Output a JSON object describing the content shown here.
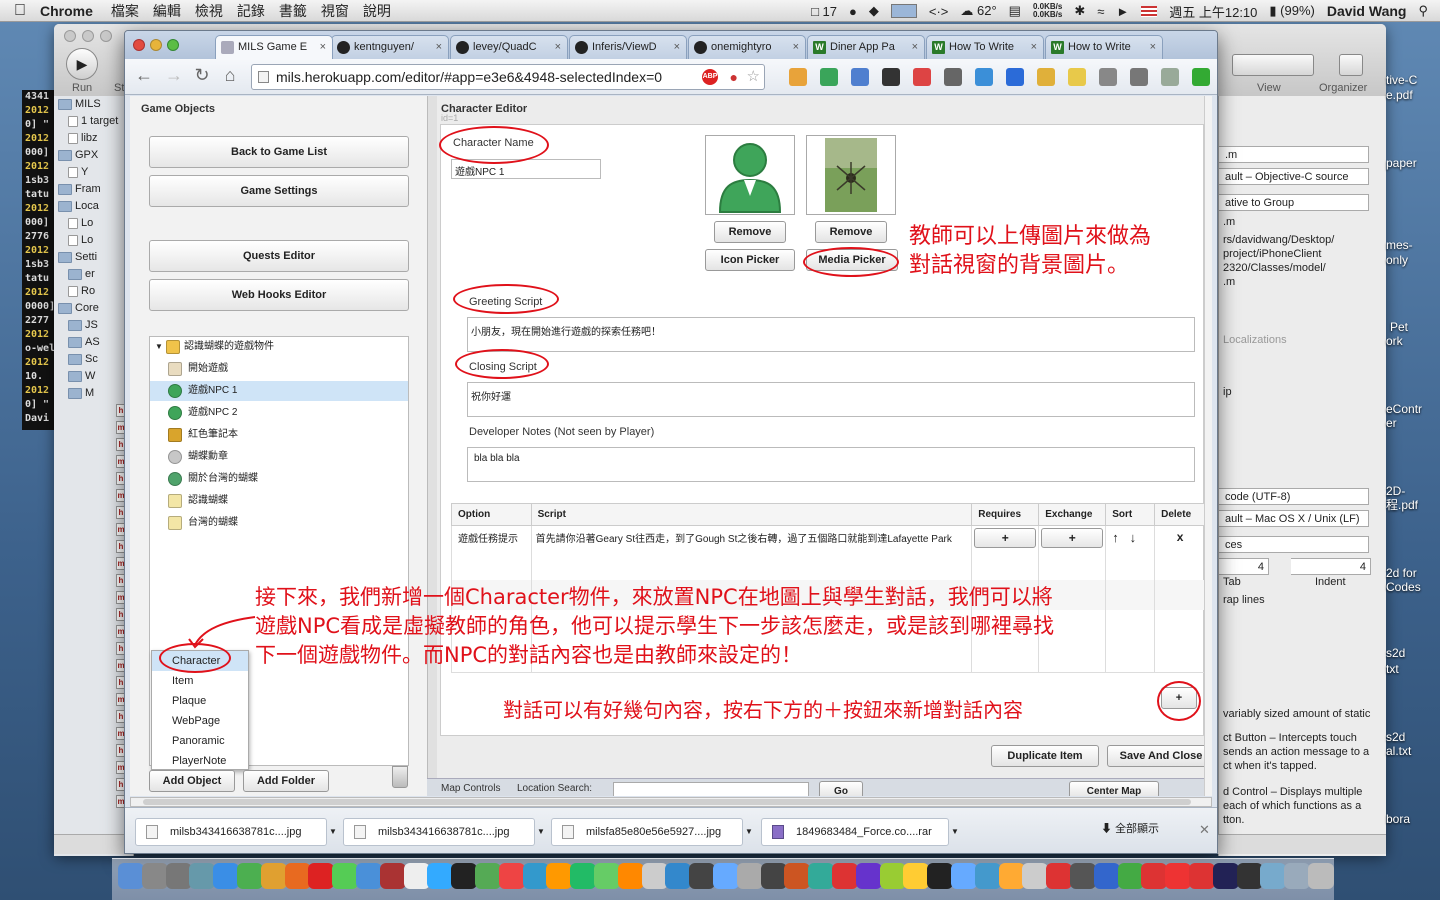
{
  "menubar": {
    "app_name": "Chrome",
    "menus": [
      "檔案",
      "編輯",
      "檢視",
      "記錄",
      "書籤",
      "視窗",
      "說明"
    ],
    "badge_count": "17",
    "temperature": "62°",
    "net_up": "0.0KB/s",
    "net_down": "0.0KB/s",
    "clock": "週五 上午12:10",
    "battery": "(99%)",
    "user": "David Wang"
  },
  "xcode": {
    "run_label": "Run",
    "stop_label": "St",
    "view_label": "View",
    "organizer_label": "Organizer",
    "nav_items": [
      "MILS",
      "1 target",
      "libz",
      "GPX",
      "Y",
      "Fram",
      "Loca",
      "Lo",
      "Lo",
      "Setti",
      "er",
      "Ro",
      "Core",
      "JS",
      "AS",
      "Sc",
      "W",
      "M"
    ],
    "right_fields": [
      ".m",
      "ault – Objective-C source",
      "ative to Group",
      ".m",
      "rs/davidwang/Desktop/",
      "project/iPhoneClient",
      "2320/Classes/model/",
      ".m",
      "Localizations",
      "ip",
      "code (UTF-8)",
      "ault – Mac OS X / Unix (LF)",
      "ces",
      "4",
      "4",
      "Tab",
      "Indent",
      "rap lines",
      "variably sized amount of static",
      "ct Button – Intercepts touch",
      "sends an action message to a",
      "ct when it's tapped.",
      "d Control – Displays multiple",
      "each of which functions as a",
      "tton."
    ]
  },
  "terminal_lines": [
    "4341",
    "2012",
    "0] \"",
    "2012",
    "000]",
    "2012",
    "1sb3",
    "tatu",
    "2012",
    "000]",
    "2776",
    "2012",
    "1sb3",
    "tatu",
    "2012",
    "0000]",
    "2277",
    "2012",
    "o-wel",
    "2012",
    "10.",
    "2012",
    "0] \"",
    "Davi"
  ],
  "desktop_files": [
    "tive-C",
    "e.pdf",
    "paper",
    "mes-",
    "only",
    "Pet",
    "ork",
    "eContr",
    "er",
    "2D-",
    "程.pdf",
    "2d for",
    "Codes",
    "s2d",
    "txt",
    "s2d",
    "al.txt",
    "bora"
  ],
  "browser": {
    "tabs": [
      "MILS Game E",
      "kentnguyen/",
      "levey/QuadC",
      "Inferis/ViewD",
      "onemightyro",
      "Diner App Pa",
      "How To Write",
      "How to Write"
    ],
    "url": "mils.herokuapp.com/editor/#app=e3e6&4948-selectedIndex=0"
  },
  "left_panel": {
    "title": "Game Objects",
    "buttons": [
      "Back to Game List",
      "Game Settings",
      "Quests Editor",
      "Web Hooks Editor"
    ],
    "tree": [
      {
        "label": "認識蝴蝶的遊戲物件",
        "icon": "folder-icon"
      },
      {
        "label": "開始遊戲",
        "icon": "scroll-icon"
      },
      {
        "label": "遊戲NPC 1",
        "icon": "person-icon"
      },
      {
        "label": "遊戲NPC 2",
        "icon": "person-icon"
      },
      {
        "label": "紅色筆記本",
        "icon": "box-icon"
      },
      {
        "label": "蝴蝶勳章",
        "icon": "medal-icon"
      },
      {
        "label": "關於台灣的蝴蝶",
        "icon": "globe-icon"
      },
      {
        "label": "認識蝴蝶",
        "icon": "page-icon"
      },
      {
        "label": "台灣的蝴蝶",
        "icon": "page-icon"
      }
    ],
    "popup_items": [
      "Character",
      "Item",
      "Plaque",
      "WebPage",
      "Panoramic",
      "PlayerNote"
    ],
    "add_object": "Add Object",
    "add_folder": "Add Folder"
  },
  "editor": {
    "title": "Character Editor",
    "id_label": "id=1",
    "name_label": "Character Name",
    "name_value": "遊戲NPC 1",
    "remove_label": "Remove",
    "remove2_label": "Remove",
    "icon_picker": "Icon Picker",
    "media_picker": "Media Picker",
    "greeting_label": "Greeting Script",
    "greeting_value": "小朋友，現在開始進行遊戲的探索任務吧！",
    "closing_label": "Closing Script",
    "closing_value": "祝你好運",
    "notes_label": "Developer Notes (Not seen by Player)",
    "notes_value": "bla bla bla",
    "table_headers": [
      "Option",
      "Script",
      "Requires",
      "Exchange",
      "Sort",
      "Delete"
    ],
    "row": {
      "option": "遊戲任務提示",
      "script": "首先請你沿著Geary St往西走，到了Gough St之後右轉，過了五個路口就能到達Lafayette Park",
      "requires": "+",
      "exchange": "+",
      "sort_up": "↑",
      "sort_down": "↓",
      "delete": "x"
    },
    "add_row": "+",
    "duplicate": "Duplicate Item",
    "save": "Save And Close",
    "map_controls": "Map Controls",
    "location_search": "Location Search:",
    "go": "Go",
    "center_map": "Center Map"
  },
  "annotations": {
    "media_note_1": "教師可以上傳圖片來做為",
    "media_note_2": "對話視窗的背景圖片。",
    "char_note_1": "接下來，我們新增一個Character物件，來放置NPC在地圖上與學生對話，我們可以將",
    "char_note_2": "遊戲NPC看成是虛擬教師的角色，他可以提示學生下一步該怎麼走，或是該到哪裡尋找",
    "char_note_3": "下一個遊戲物件。而NPC的對話內容也是由教師來設定的！",
    "add_note": "對話可以有好幾句內容，按右下方的＋按鈕來新增對話內容"
  },
  "downloads": {
    "items": [
      "milsb343416638781c....jpg",
      "milsb343416638781c....jpg",
      "milsfa85e80e56e5927....jpg",
      "1849683484_Force.co....rar"
    ],
    "show_all": "全部顯示"
  },
  "colors": {
    "annotation": "#e0111a",
    "selection": "#cfe4f7"
  }
}
